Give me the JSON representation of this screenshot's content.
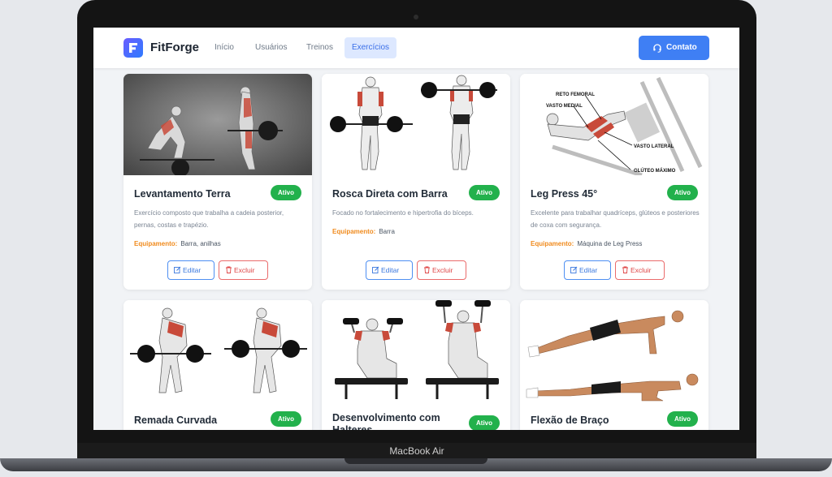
{
  "device": {
    "label": "MacBook Air"
  },
  "navbar": {
    "brand": "FitForge",
    "links": [
      "Início",
      "Usuários",
      "Treinos",
      "Exercícios"
    ],
    "active": "Exercícios",
    "contact_label": "Contato"
  },
  "equipment_label": "Equipamento:",
  "edit_label": "Editar",
  "delete_label": "Excluir",
  "colors": {
    "accent": "#3f7ff4",
    "status": "#22b14c",
    "equipment": "#f08a1c",
    "delete": "#df4545"
  },
  "exercises": [
    {
      "name": "Levantamento Terra",
      "status": "Ativo",
      "description": "Exercício composto que trabalha a cadeia posterior, pernas, costas e trapézio.",
      "equipment": "Barra, anilhas"
    },
    {
      "name": "Rosca Direta com Barra",
      "status": "Ativo",
      "description": "Focado no fortalecimento e hipertrofia do bíceps.",
      "equipment": "Barra"
    },
    {
      "name": "Leg Press 45°",
      "status": "Ativo",
      "description": "Excelente para trabalhar quadríceps, glúteos e posteriores de coxa com segurança.",
      "equipment": "Máquina de Leg Press",
      "image_labels": [
        "RETO FEMORAL",
        "VASTO MEDIAL",
        "VASTO LATERAL",
        "GLÚTEO MÁXIMO"
      ]
    },
    {
      "name": "Remada Curvada",
      "status": "Ativo"
    },
    {
      "name": "Desenvolvimento com Halteres",
      "status": "Ativo"
    },
    {
      "name": "Flexão de Braço",
      "status": "Ativo"
    }
  ]
}
